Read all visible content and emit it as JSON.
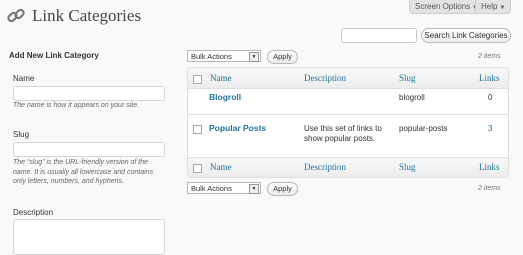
{
  "header": {
    "title": "Link Categories",
    "screen_options": "Screen Options",
    "help": "Help",
    "icon": "link-chain-icon"
  },
  "search": {
    "placeholder": "",
    "button_label": "Search Link Categories"
  },
  "form": {
    "heading": "Add New Link Category",
    "name_label": "Name",
    "name_hint": "The name is how it appears on your site.",
    "slug_label": "Slug",
    "slug_hint": "The “slug” is the URL-friendly version of the name. It is usually all lowercase and contains only letters, numbers, and hyphens.",
    "description_label": "Description"
  },
  "bulk": {
    "select_label": "Bulk Actions",
    "apply_label": "Apply",
    "item_count": "2 items"
  },
  "table": {
    "columns": [
      "Name",
      "Description",
      "Slug",
      "Links"
    ],
    "rows": [
      {
        "name": "Blogroll",
        "description": "",
        "slug": "blogroll",
        "links": "0"
      },
      {
        "name": "Popular Posts",
        "description": "Use this set of links to show popular posts.",
        "slug": "popular-posts",
        "links": "3"
      }
    ]
  },
  "colors": {
    "link": "#21759b",
    "background": "#f9f9f9"
  }
}
